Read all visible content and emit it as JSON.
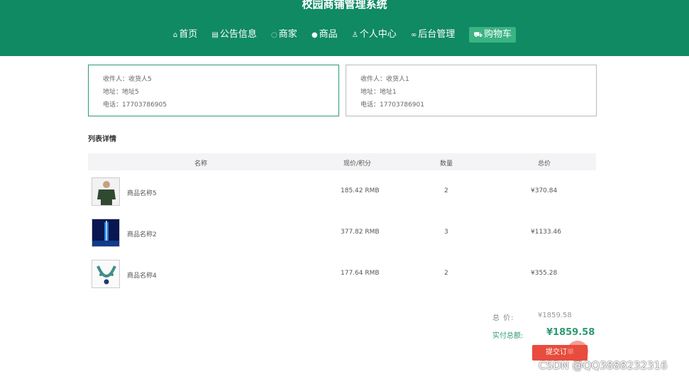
{
  "site_title": "校园商铺管理系统",
  "nav": [
    {
      "icon": "home-icon",
      "glyph": "⌂",
      "label": "首页"
    },
    {
      "icon": "notice-icon",
      "glyph": "▤",
      "label": "公告信息"
    },
    {
      "icon": "shop-icon",
      "glyph": "◌",
      "label": "商家"
    },
    {
      "icon": "goods-icon",
      "glyph": "●",
      "label": "商品"
    },
    {
      "icon": "user-icon",
      "glyph": "♙",
      "label": "个人中心"
    },
    {
      "icon": "link-icon",
      "glyph": "∞",
      "label": "后台管理"
    },
    {
      "icon": "cart-icon",
      "glyph": "⛟",
      "label": "购物车"
    }
  ],
  "addresses": [
    {
      "recipient": "收件人：收货人5",
      "address": "地址：地址5",
      "phone": "电话：17703786905"
    },
    {
      "recipient": "收件人：收货人1",
      "address": "地址：地址1",
      "phone": "电话：17703786901"
    }
  ],
  "section_title": "列表详情",
  "table": {
    "headers": [
      "名称",
      "现价/积分",
      "数量",
      "总价"
    ],
    "rows": [
      {
        "name": "商品名称5",
        "price": "185.42 RMB",
        "qty": "2",
        "total": "¥370.84"
      },
      {
        "name": "商品名称2",
        "price": "377.82 RMB",
        "qty": "3",
        "total": "¥1133.46"
      },
      {
        "name": "商品名称4",
        "price": "177.64 RMB",
        "qty": "2",
        "total": "¥355.28"
      }
    ]
  },
  "summary": {
    "total_label": "总 价:",
    "total_value": "¥1859.58",
    "paid_label": "实付总额:",
    "paid_value": "¥1859.58"
  },
  "submit_label": "提交订单",
  "watermark": "CSDN @QQ3888232316",
  "colors": {
    "primary": "#0f8a62",
    "accent": "#2d9a71",
    "danger": "#e74c3c"
  }
}
